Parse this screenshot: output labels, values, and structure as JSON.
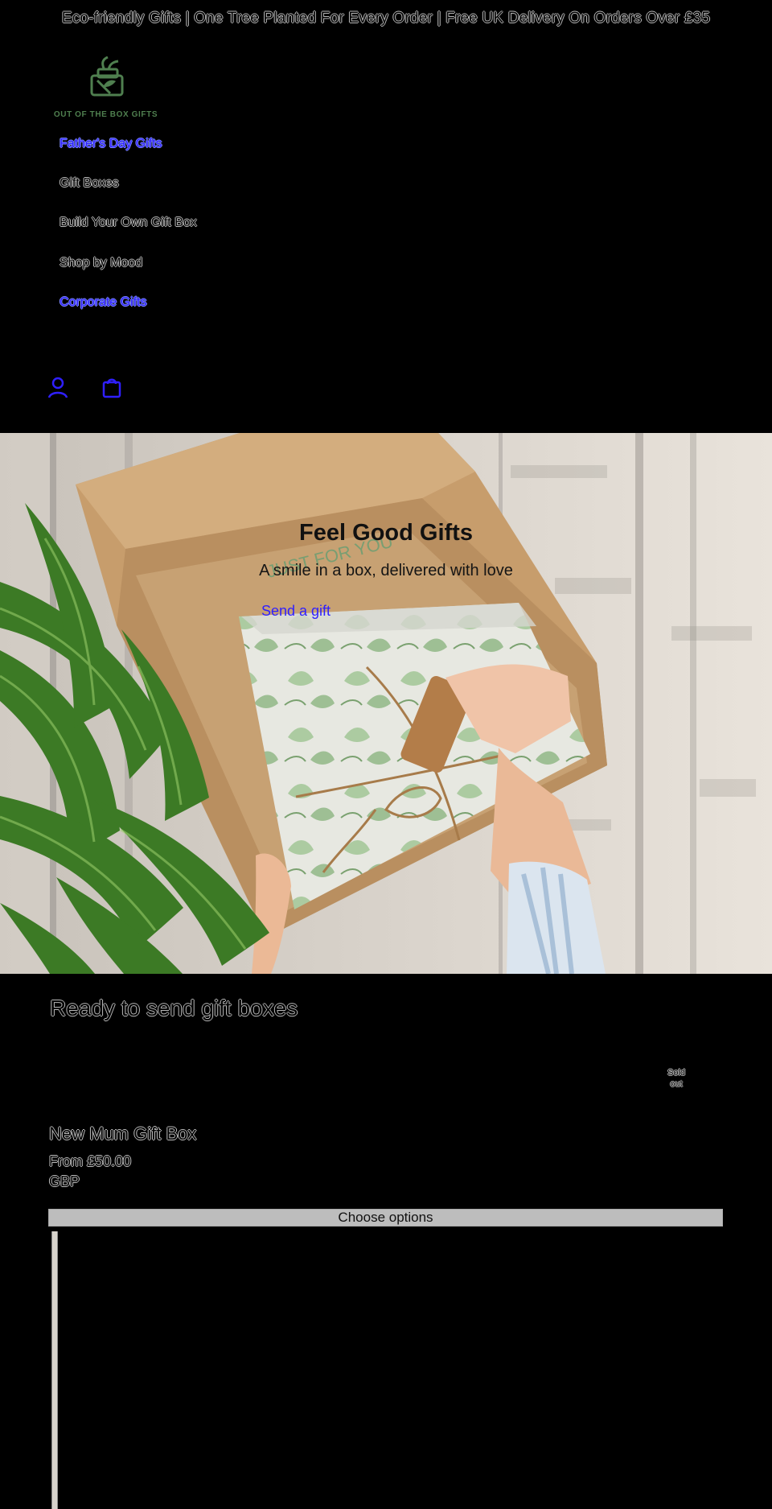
{
  "announcement": {
    "text": "Eco-friendly Gifts | One Tree Planted For Every Order | Free UK Delivery On Orders Over £35"
  },
  "brand": {
    "name": "OUT OF THE BOX GIFTS",
    "logo_icon": "gift-box-leaf-icon",
    "logo_color": "#4f7f4f"
  },
  "nav": {
    "items": [
      {
        "label": "Father's Day Gifts",
        "type": "link"
      },
      {
        "label": "Gift Boxes",
        "type": "menu"
      },
      {
        "label": "Build Your Own Gift Box",
        "type": "menu"
      },
      {
        "label": "Shop by Mood",
        "type": "menu"
      },
      {
        "label": "Corporate Gifts",
        "type": "link"
      }
    ]
  },
  "header": {
    "account_icon": "account-icon",
    "cart_icon": "bag-icon",
    "icon_color": "#2f1fff"
  },
  "hero": {
    "title": "Feel Good Gifts",
    "subtitle": "A smile in a box, delivered with love",
    "cta_label": "Send a gift",
    "cta_color": "#2f1fff",
    "image_tag_text": "JUST FOR YOU"
  },
  "products": {
    "section_title": "Ready to send gift boxes",
    "badge": "Sold out",
    "title": "New Mum Gift Box",
    "price_line_1": "From £50.00",
    "price_line_2": "GBP",
    "button_label": "Choose options"
  }
}
